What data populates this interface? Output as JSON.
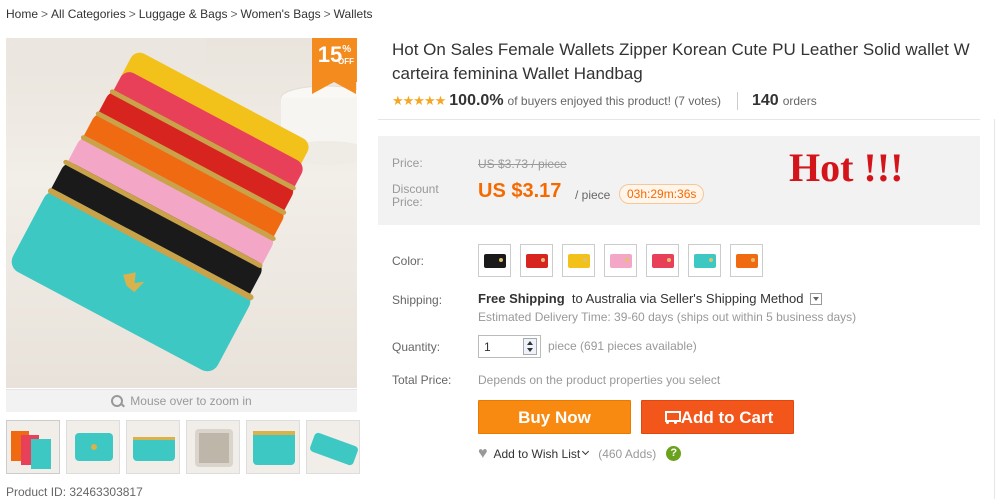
{
  "breadcrumb": {
    "items": [
      "Home",
      "All Categories",
      "Luggage & Bags",
      "Women's Bags",
      "Wallets"
    ],
    "separator": ">"
  },
  "image": {
    "discount_value": "15",
    "discount_pct_sign": "%",
    "discount_off": "OFF",
    "zoom_hint": "Mouse over to zoom in",
    "thumbnail_count": 6,
    "wallet_colors": [
      "#f2c21a",
      "#e9405a",
      "#d8241f",
      "#f06a12",
      "#f4a6c7",
      "#1a1a1a",
      "#3ec8c4"
    ]
  },
  "product": {
    "id_label": "Product ID: 32463303817",
    "title_line1": "Hot On Sales Female Wallets Zipper Korean Cute PU Leather Solid wallet W",
    "title_line2": "carteira feminina Wallet Handbag",
    "rating_stars": "★★★★★",
    "rating_pct": "100.0%",
    "rating_text": "of buyers enjoyed this product! (7 votes)",
    "orders_count": "140",
    "orders_label": "orders"
  },
  "price": {
    "price_label": "Price:",
    "old_price": "US $3.73 / piece",
    "discount_label_1": "Discount",
    "discount_label_2": "Price:",
    "discount_price": "US $3.17",
    "per_piece": "/ piece",
    "timer": "03h:29m:36s",
    "hot_text": "Hot !!!"
  },
  "options": {
    "color_label": "Color:",
    "colors": [
      "#1a1a1a",
      "#d8241f",
      "#f2c21a",
      "#f4a6c7",
      "#e9405a",
      "#3ec8c4",
      "#f06a12"
    ],
    "shipping_label": "Shipping:",
    "free_shipping": "Free Shipping",
    "shipping_to": "to Australia via Seller's Shipping Method",
    "shipping_est": "Estimated Delivery Time: 39-60 days (ships out within 5 business days)",
    "quantity_label": "Quantity:",
    "quantity_value": "1",
    "quantity_avail": "piece (691 pieces available)",
    "total_label": "Total Price:",
    "total_value": "Depends on the product properties you select"
  },
  "actions": {
    "buy_now": "Buy Now",
    "add_to_cart": "Add to Cart",
    "wish_list": "Add to Wish List",
    "wish_count": "(460 Adds)",
    "help": "?"
  }
}
